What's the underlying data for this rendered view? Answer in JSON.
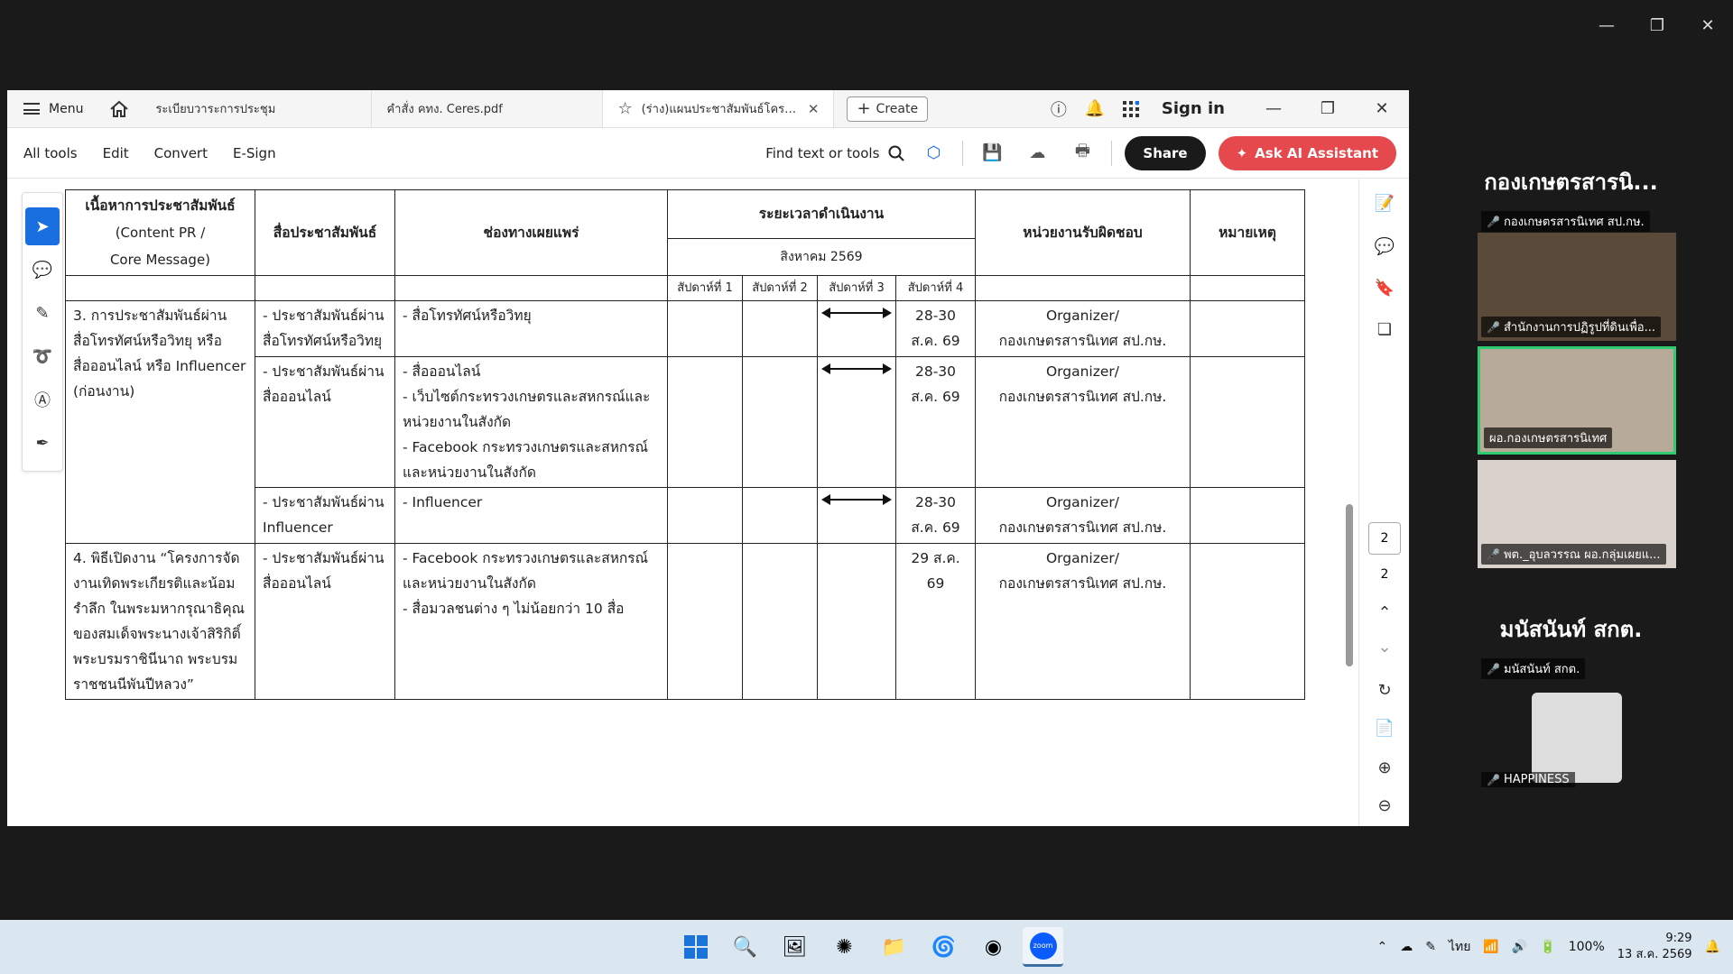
{
  "acrobat": {
    "menu_label": "Menu",
    "tabs": [
      {
        "label": "ระเบียบวาระการประชุม"
      },
      {
        "label": "คำสั่ง คทง. Ceres.pdf"
      },
      {
        "label": "(ร่าง)แผนประชาสัมพันธ์โครงกา..."
      }
    ],
    "create_label": "Create",
    "sign_in": "Sign in",
    "toolbar": {
      "all_tools": "All tools",
      "edit": "Edit",
      "convert": "Convert",
      "esign": "E-Sign",
      "find": "Find text or tools",
      "share": "Share",
      "ai": "Ask AI Assistant"
    },
    "page_current": "2",
    "page_total": "2"
  },
  "table": {
    "headers": {
      "content": "เนื้อหาการประชาสัมพันธ์",
      "content_sub": "(Content PR /\nCore Message)",
      "media": "สื่อประชาสัมพันธ์",
      "channel": "ช่องทางเผยแพร่",
      "period": "ระยะเวลาดำเนินงาน",
      "month": "สิงหาคม 2569",
      "weeks": [
        "สัปดาห์ที่ 1",
        "สัปดาห์ที่ 2",
        "สัปดาห์ที่ 3",
        "สัปดาห์ที่ 4"
      ],
      "responsible": "หน่วยงานรับผิดชอบ",
      "remark": "หมายเหตุ"
    },
    "rows": [
      {
        "content": "3. การประชาสัมพันธ์ผ่าน\nสื่อโทรทัศน์หรือวิทยุ หรือ\nสื่อออนไลน์ หรือ Influencer\n(ก่อนงาน)",
        "media": "- ประชาสัมพันธ์ผ่าน\nสื่อโทรทัศน์หรือวิทยุ",
        "channel": "- สื่อโทรทัศน์หรือวิทยุ",
        "week4": "28-30\nส.ค. 69",
        "responsible": "Organizer/\nกองเกษตรสารนิเทศ สป.กษ."
      },
      {
        "media": "- ประชาสัมพันธ์ผ่าน\nสื่อออนไลน์",
        "channel": "- สื่อออนไลน์\n- เว็บไซต์กระทรวงเกษตรและสหกรณ์และ\nหน่วยงานในสังกัด\n- Facebook กระทรวงเกษตรและสหกรณ์\nและหน่วยงานในสังกัด",
        "week4": "28-30\nส.ค. 69",
        "responsible": "Organizer/\nกองเกษตรสารนิเทศ สป.กษ."
      },
      {
        "media": "- ประชาสัมพันธ์ผ่าน\nInfluencer",
        "channel": "- Influencer",
        "week4": "28-30\nส.ค. 69",
        "responsible": "Organizer/\nกองเกษตรสารนิเทศ สป.กษ."
      },
      {
        "content": "4. พิธีเปิดงาน “โครงการจัด\nงานเทิดพระเกียรติและน้อม\nรำลึก ในพระมหากรุณาธิคุณ\nของสมเด็จพระนางเจ้าสิริกิติ์\nพระบรมราชินีนาถ พระบรม\nราชชนนีพันปีหลวง”",
        "media": "- ประชาสัมพันธ์ผ่าน\nสื่อออนไลน์",
        "channel": "- Facebook กระทรวงเกษตรและสหกรณ์\nและหน่วยงานในสังกัด\n- สื่อมวลชนต่าง ๆ ไม่น้อยกว่า 10 สื่อ",
        "week4": "29 ส.ค.\n69",
        "responsible": "Organizer/\nกองเกษตรสารนิเทศ สป.กษ."
      }
    ]
  },
  "zoom": {
    "group1_title": "กองเกษตรสารนิ...",
    "group1_label": "กองเกษตรสารนิเทศ สป.กษ.",
    "tiles": [
      {
        "label": "สำนักงานการปฏิรูปที่ดินเพื่อ..."
      },
      {
        "label": "ผอ.กองเกษตรสารนิเทศ"
      },
      {
        "label": "พต._อุบลวรรณ ผอ.กลุ่มเผยแ..."
      }
    ],
    "group2_title": "มนัสนันท์ สกต.",
    "group2_label": "มนัสนันท์ สกต.",
    "happiness": "HAPPINESS"
  },
  "taskbar": {
    "lang": "ไทย",
    "battery": "100%",
    "time": "9:29",
    "date": "13 ส.ค. 2569"
  },
  "colors": {
    "accent": "#1a6fe0",
    "ai_button": "#e5484d",
    "speaker_border": "#2ecc71"
  }
}
